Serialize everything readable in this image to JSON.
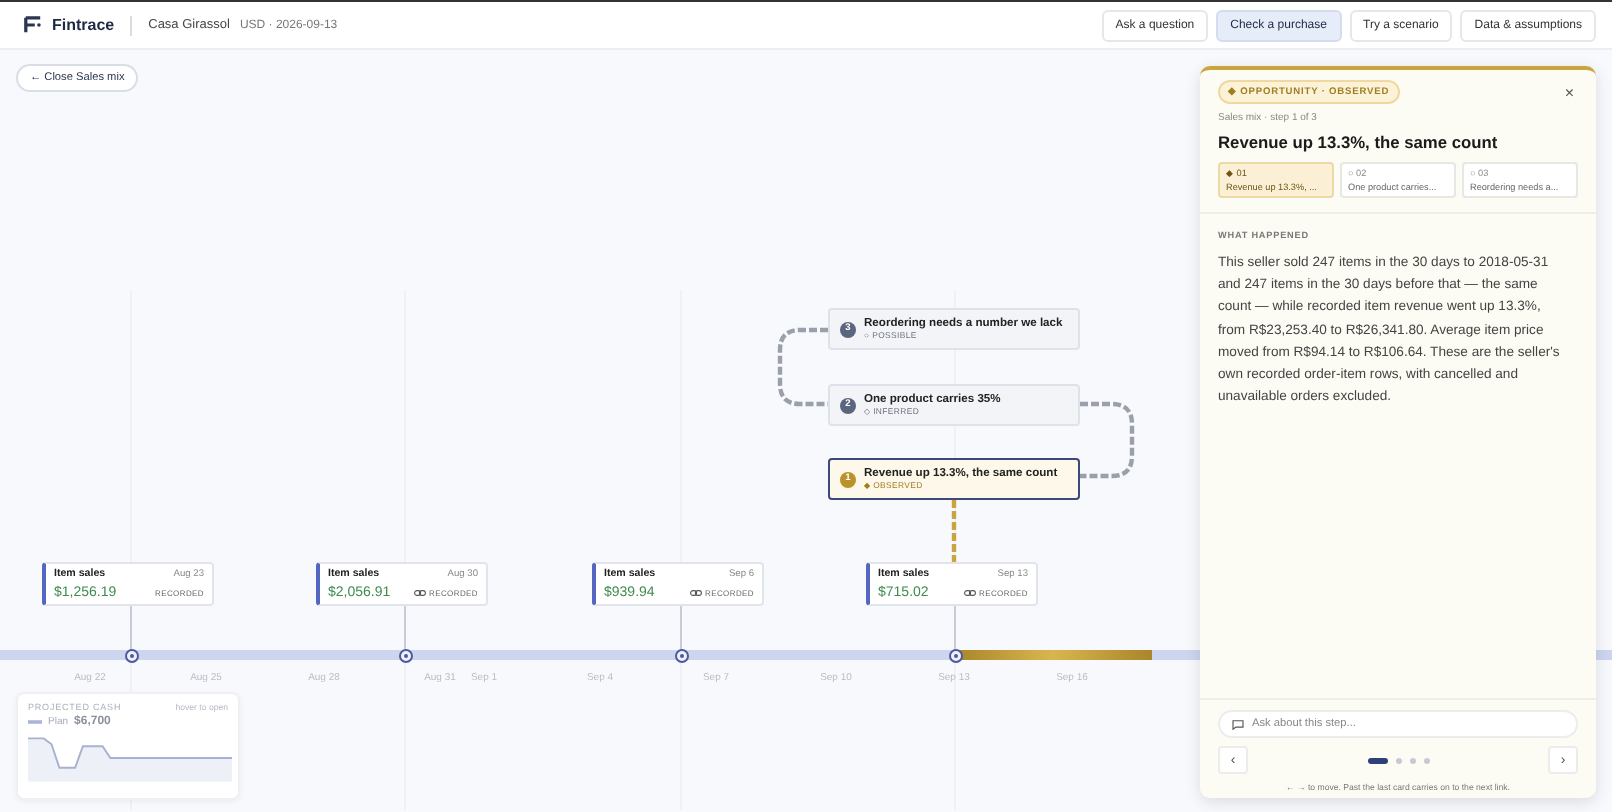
{
  "topbar": {
    "brand": "Fintrace",
    "company": "Casa Girassol",
    "meta": "USD · 2026-09-13",
    "nav": [
      {
        "label": "Ask a question",
        "selected": false
      },
      {
        "label": "Check a purchase",
        "selected": true
      },
      {
        "label": "Try a scenario",
        "selected": false
      },
      {
        "label": "Data & assumptions",
        "selected": false
      }
    ]
  },
  "close_button": "← Close Sales mix",
  "timeline": {
    "axis_labels": [
      "Aug 22",
      "Aug 25",
      "Aug 28",
      "Aug 31",
      "Sep 1",
      "Sep 4",
      "Sep 7",
      "Sep 10",
      "Sep 13",
      "Sep 16"
    ],
    "events": [
      {
        "title": "Item sales",
        "date": "Aug 23",
        "amount": "$1,256.19",
        "status": "RECORDED",
        "linked": false
      },
      {
        "title": "Item sales",
        "date": "Aug 30",
        "amount": "$2,056.91",
        "status": "RECORDED",
        "linked": true
      },
      {
        "title": "Item sales",
        "date": "Sep 6",
        "amount": "$939.94",
        "status": "RECORDED",
        "linked": true
      },
      {
        "title": "Item sales",
        "date": "Sep 13",
        "amount": "$715.02",
        "status": "RECORDED",
        "linked": true
      }
    ],
    "chain": [
      {
        "number": "3",
        "title": "Reordering needs a number we lack",
        "status": "○ POSSIBLE",
        "kind": "possible",
        "selected": false
      },
      {
        "number": "2",
        "title": "One product carries 35%",
        "status": "◇ INFERRED",
        "kind": "inferred",
        "selected": false
      },
      {
        "number": "1",
        "title": "Revenue up 13.3%, the same count",
        "status": "◆ OBSERVED",
        "kind": "observed",
        "selected": true
      }
    ]
  },
  "projected_cash": {
    "title": "PROJECTED CASH",
    "hint": "hover to open",
    "legend": "Plan",
    "value": "$6,700"
  },
  "panel": {
    "badge": "◆ OPPORTUNITY · OBSERVED",
    "close": "×",
    "crumb": "Sales mix · step 1 of 3",
    "title": "Revenue up 13.3%, the same count",
    "steps": [
      {
        "number": "◆ 01",
        "label": "Revenue up 13.3%, ...",
        "selected": true
      },
      {
        "number": "○ 02",
        "label": "One product carries...",
        "selected": false
      },
      {
        "number": "○ 03",
        "label": "Reordering needs a...",
        "selected": false
      }
    ],
    "section_label": "WHAT HAPPENED",
    "body": "This seller sold 247 items in the 30 days to 2018-05-31 and 247 items in the 30 days before that — the same count — while recorded item revenue went up 13.3%, from R$23,253.40 to R$26,341.80. Average item price moved from R$94.14 to R$106.64. These are the seller's own recorded order-item rows, with cancelled and unavailable orders excluded.",
    "ask_placeholder": "Ask about this step...",
    "prev": "‹",
    "next": "›",
    "dots": [
      {
        "selected": true
      },
      {
        "selected": false
      },
      {
        "selected": false
      },
      {
        "selected": false
      }
    ],
    "hint": "← → to move. Past the last card carries on to the next link."
  }
}
